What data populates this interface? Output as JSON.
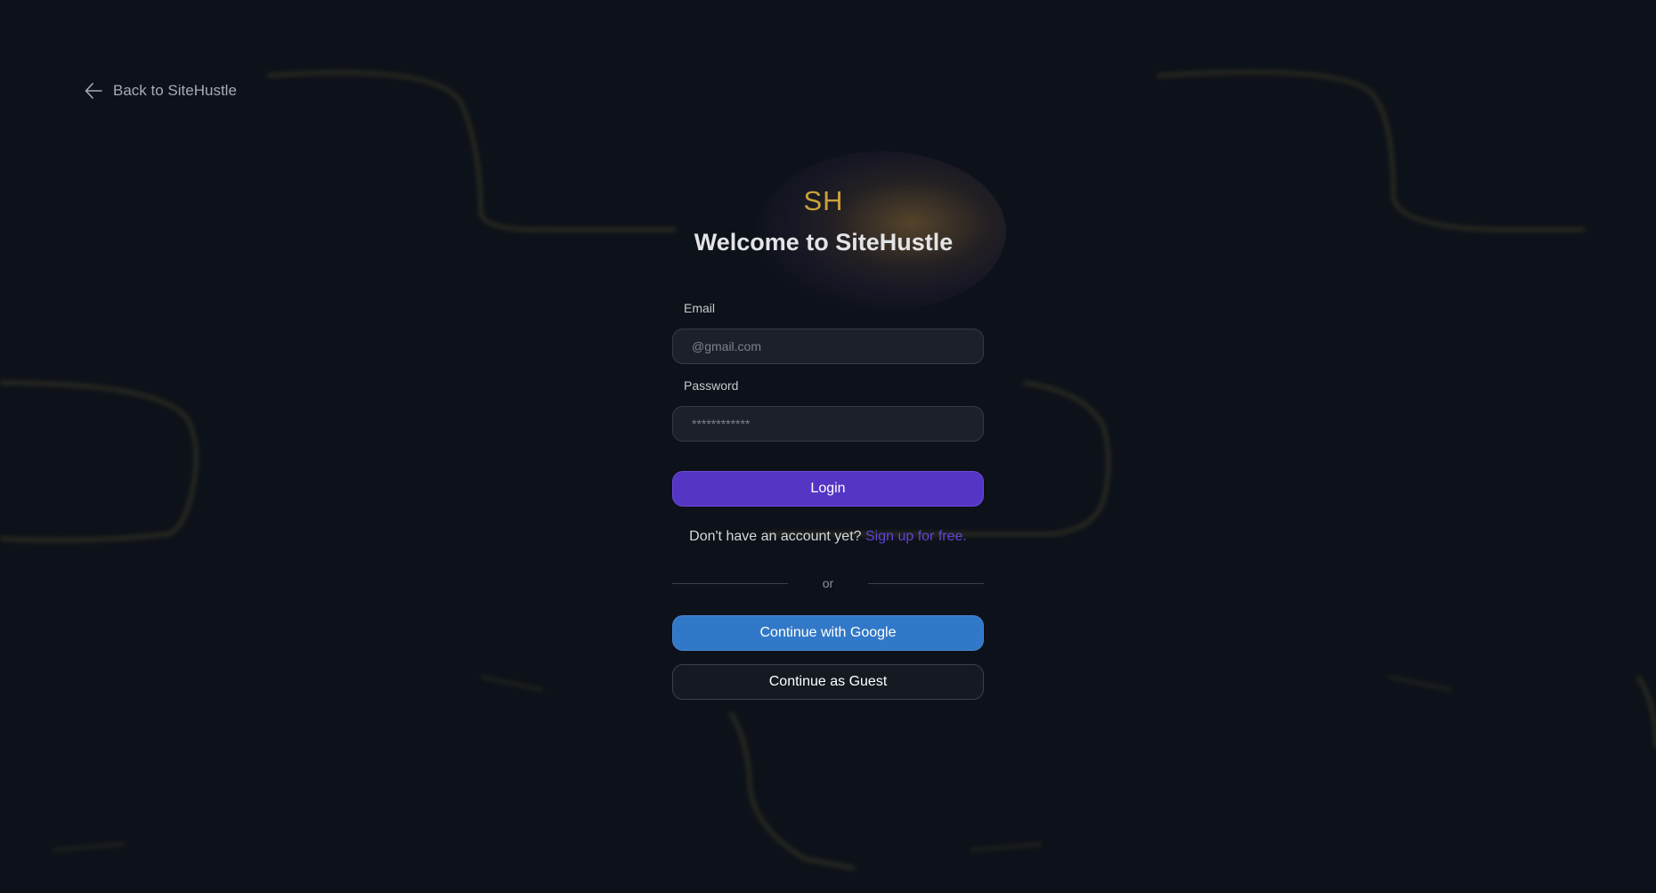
{
  "nav": {
    "back_label": "Back to SiteHustle",
    "back_icon": "arrow-left-icon"
  },
  "brand": {
    "logo_text": "SH",
    "welcome_title": "Welcome to SiteHustle",
    "logo_color": "#c9a23a"
  },
  "form": {
    "email_label": "Email",
    "email_placeholder": "@gmail.com",
    "password_label": "Password",
    "password_placeholder": "************",
    "login_label": "Login",
    "signup_prompt": "Don't have an account yet?",
    "signup_link": "Sign up for free.",
    "divider_text": "or",
    "google_label": "Continue with Google",
    "guest_label": "Continue as Guest"
  },
  "colors": {
    "background": "#0d1119",
    "login_button": "#5535c4",
    "google_button": "#3278c8",
    "link": "#5f45d6"
  }
}
